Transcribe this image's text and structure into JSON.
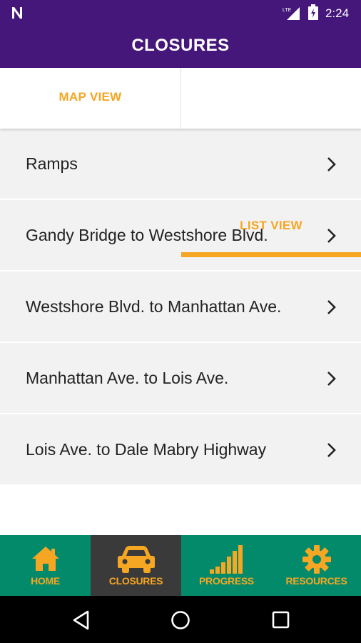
{
  "status_bar": {
    "time": "2:24",
    "network": "LTE"
  },
  "app_bar": {
    "title": "CLOSURES"
  },
  "tabs": [
    {
      "label": "MAP VIEW",
      "selected": false
    },
    {
      "label": "LIST VIEW",
      "selected": true
    }
  ],
  "list": {
    "items": [
      {
        "label": "Ramps"
      },
      {
        "label": "Gandy Bridge to Westshore Blvd."
      },
      {
        "label": "Westshore Blvd. to Manhattan Ave."
      },
      {
        "label": "Manhattan Ave. to Lois Ave."
      },
      {
        "label": "Lois Ave. to Dale Mabry Highway"
      }
    ]
  },
  "bottom_nav": {
    "items": [
      {
        "label": "HOME",
        "icon": "home-icon",
        "active": false
      },
      {
        "label": "CLOSURES",
        "icon": "car-icon",
        "active": true
      },
      {
        "label": "PROGRESS",
        "icon": "progress-bars-icon",
        "active": false
      },
      {
        "label": "RESOURCES",
        "icon": "gear-icon",
        "active": false
      }
    ]
  },
  "colors": {
    "header": "#45177a",
    "accent": "#f5a623",
    "nav_bg": "#028a6b",
    "nav_active_bg": "#3a3a3a"
  }
}
